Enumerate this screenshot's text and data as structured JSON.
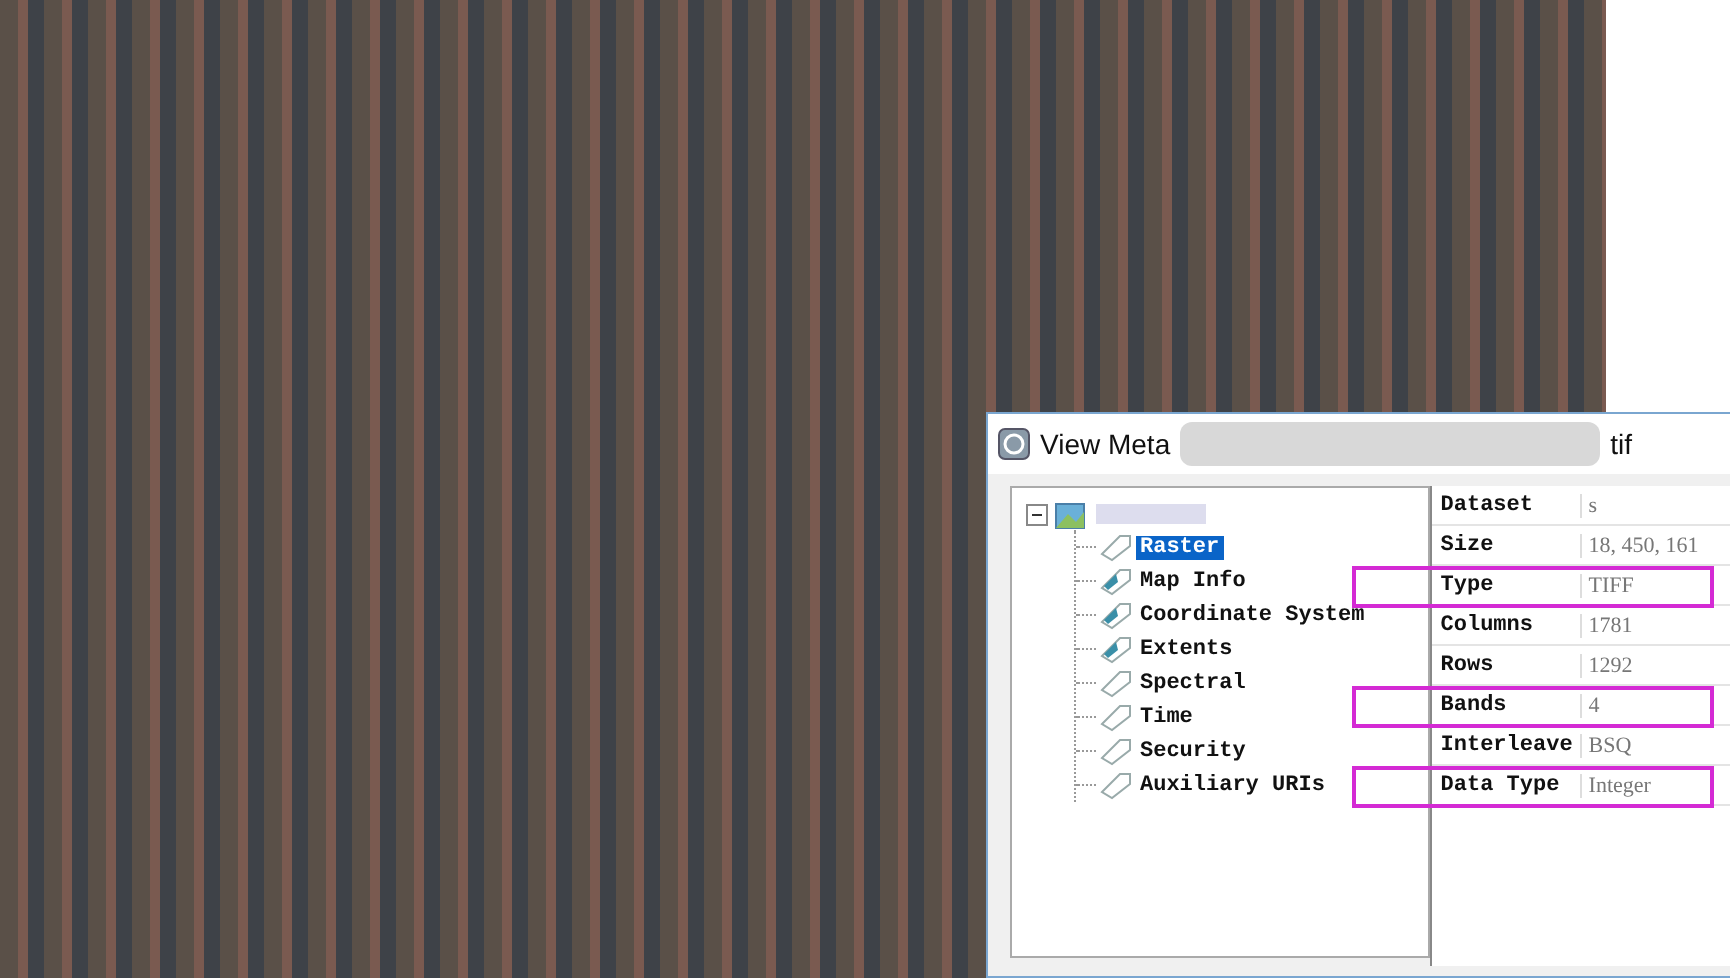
{
  "dialog": {
    "title_start": "View Meta",
    "title_end": "tif"
  },
  "tree": {
    "items": [
      {
        "label": "Raster",
        "selected": true
      },
      {
        "label": "Map Info",
        "selected": false
      },
      {
        "label": "Coordinate System",
        "selected": false
      },
      {
        "label": "Extents",
        "selected": false
      },
      {
        "label": "Spectral",
        "selected": false
      },
      {
        "label": "Time",
        "selected": false
      },
      {
        "label": "Security",
        "selected": false
      },
      {
        "label": "Auxiliary URIs",
        "selected": false
      }
    ]
  },
  "table": {
    "rows": [
      {
        "name": "Dataset",
        "value": "s",
        "highlighted": false
      },
      {
        "name": "Size",
        "value": "18, 450, 161",
        "highlighted": false
      },
      {
        "name": "Type",
        "value": "TIFF",
        "highlighted": true
      },
      {
        "name": "Columns",
        "value": "1781",
        "highlighted": false
      },
      {
        "name": "Rows",
        "value": "1292",
        "highlighted": false
      },
      {
        "name": "Bands",
        "value": "4",
        "highlighted": true
      },
      {
        "name": "Interleave",
        "value": "BSQ",
        "highlighted": false
      },
      {
        "name": "Data Type",
        "value": "Integer",
        "highlighted": true
      }
    ]
  }
}
